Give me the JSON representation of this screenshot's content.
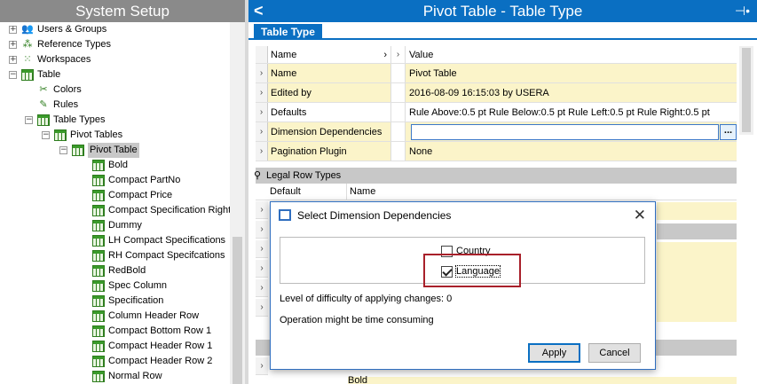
{
  "left_panel": {
    "title": "System Setup",
    "tree": [
      {
        "label": "Users & Groups",
        "depth": 0,
        "expander": "+",
        "icon": "users-icon"
      },
      {
        "label": "Reference Types",
        "depth": 0,
        "expander": "+",
        "icon": "reference-types-icon"
      },
      {
        "label": "Workspaces",
        "depth": 0,
        "expander": "+",
        "icon": "workspaces-icon"
      },
      {
        "label": "Table",
        "depth": 0,
        "expander": "−",
        "icon": "table-icon"
      },
      {
        "label": "Colors",
        "depth": 1,
        "expander": "",
        "icon": "colors-icon"
      },
      {
        "label": "Rules",
        "depth": 1,
        "expander": "",
        "icon": "rules-icon"
      },
      {
        "label": "Table Types",
        "depth": 1,
        "expander": "−",
        "icon": "table-types-icon"
      },
      {
        "label": "Pivot Tables",
        "depth": 2,
        "expander": "−",
        "icon": "pivot-tables-icon"
      },
      {
        "label": "Pivot Table",
        "depth": 3,
        "expander": "−",
        "icon": "pivot-table-icon",
        "selected": true
      },
      {
        "label": "Bold",
        "depth": 4,
        "expander": "",
        "icon": "table-type-icon"
      },
      {
        "label": "Compact PartNo",
        "depth": 4,
        "expander": "",
        "icon": "table-type-icon"
      },
      {
        "label": "Compact Price",
        "depth": 4,
        "expander": "",
        "icon": "table-type-icon"
      },
      {
        "label": "Compact Specification Right",
        "depth": 4,
        "expander": "",
        "icon": "table-type-icon"
      },
      {
        "label": "Dummy",
        "depth": 4,
        "expander": "",
        "icon": "table-type-icon"
      },
      {
        "label": "LH Compact Specifications",
        "depth": 4,
        "expander": "",
        "icon": "table-type-icon"
      },
      {
        "label": "RH Compact Specifcations",
        "depth": 4,
        "expander": "",
        "icon": "table-type-icon"
      },
      {
        "label": "RedBold",
        "depth": 4,
        "expander": "",
        "icon": "table-type-icon"
      },
      {
        "label": "Spec Column",
        "depth": 4,
        "expander": "",
        "icon": "table-type-icon"
      },
      {
        "label": "Specification",
        "depth": 4,
        "expander": "",
        "icon": "table-type-icon"
      },
      {
        "label": "Column Header Row",
        "depth": 4,
        "expander": "",
        "icon": "table-type-icon"
      },
      {
        "label": "Compact Bottom Row 1",
        "depth": 4,
        "expander": "",
        "icon": "table-type-icon"
      },
      {
        "label": "Compact Header Row 1",
        "depth": 4,
        "expander": "",
        "icon": "table-type-icon"
      },
      {
        "label": "Compact Header Row 2",
        "depth": 4,
        "expander": "",
        "icon": "table-type-icon"
      },
      {
        "label": "Normal Row",
        "depth": 4,
        "expander": "",
        "icon": "table-type-icon"
      }
    ]
  },
  "right_panel": {
    "title": "Pivot Table - Table Type",
    "back_glyph": "<",
    "pin_glyph": "⊣•",
    "tab": "Table Type",
    "grid": {
      "header": {
        "name": "Name",
        "value": "Value"
      },
      "rows": [
        {
          "name": "Name",
          "value": "Pivot Table"
        },
        {
          "name": "Edited by",
          "value": "2016-08-09 16:15:03 by USERA"
        },
        {
          "name": "Defaults",
          "value": "Rule Above:0.5 pt Rule Below:0.5 pt Rule Left:0.5 pt Rule Right:0.5 pt"
        },
        {
          "name": "Dimension Dependencies",
          "value": ""
        },
        {
          "name": "Pagination Plugin",
          "value": "None"
        }
      ],
      "ellipsis_label": "..."
    },
    "legal_row_types": {
      "title": "Legal Row Types",
      "col_default": "Default",
      "col_name": "Name",
      "bottom_value": "Bold"
    }
  },
  "dialog": {
    "title": "Select Dimension Dependencies",
    "close_glyph": "✕",
    "options": [
      {
        "label": "Country",
        "checked": false
      },
      {
        "label": "Language",
        "checked": true
      }
    ],
    "difficulty_text": "Level of difficulty of applying changes: 0",
    "warning_text": "Operation might be time consuming",
    "apply_label": "Apply",
    "cancel_label": "Cancel"
  },
  "colors": {
    "accent": "#0a6fc2",
    "highlight_row": "#fbf4c9",
    "annotation_box": "#a8202a"
  }
}
